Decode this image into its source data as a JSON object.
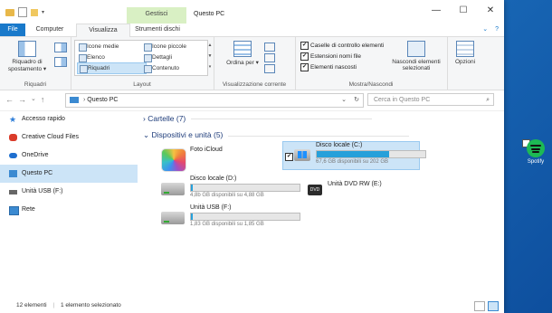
{
  "window": {
    "title": "Questo PC",
    "context_tab": "Gestisci",
    "minimize": "—",
    "maximize": "☐",
    "close": "✕"
  },
  "tabs": {
    "file": "File",
    "computer": "Computer",
    "view": "Visualizza",
    "drive_tools": "Strumenti dischi",
    "expand": "⌄",
    "help": "?"
  },
  "ribbon": {
    "panes": {
      "nav_pane": "Riquadro di spostamento ▾",
      "label": "Riquadri"
    },
    "layout": {
      "items": [
        "Icone medie",
        "Elenco",
        "Riquadri",
        "Icone piccole",
        "Dettagli",
        "Contenuto"
      ],
      "label": "Layout"
    },
    "current_view": {
      "sort": "Ordina per ▾",
      "label": "Visualizzazione corrente"
    },
    "show_hide": {
      "checkboxes": [
        "Caselle di controllo elementi",
        "Estensioni nomi file",
        "Elementi nascosti"
      ],
      "hide_selected": "Nascondi elementi selezionati",
      "label": "Mostra/Nascondi"
    },
    "options": "Opzioni"
  },
  "addressbar": {
    "nav": {
      "back": "←",
      "forward": "→",
      "recent": "⌄",
      "up": "↑"
    },
    "path": "Questo PC",
    "dropdown": "⌄",
    "refresh": "↻",
    "search_placeholder": "Cerca in Questo PC",
    "search_icon": "⌕"
  },
  "sidebar": {
    "items": [
      {
        "label": "Accesso rapido",
        "icon": "star-icon",
        "color": "#2f7ed8"
      },
      {
        "label": "Creative Cloud Files",
        "icon": "creative-cloud-icon",
        "color": "#da3b2a"
      },
      {
        "label": "OneDrive",
        "icon": "cloud-icon",
        "color": "#1e6fcf"
      },
      {
        "label": "Questo PC",
        "icon": "computer-icon",
        "color": "#3b8ad1",
        "selected": true
      },
      {
        "label": "Unità USB (F:)",
        "icon": "usb-drive-icon",
        "color": "#666666"
      },
      {
        "label": "Rete",
        "icon": "network-icon",
        "color": "#3b8ad1"
      }
    ]
  },
  "content": {
    "folders_header": "Cartelle (7)",
    "devices_header": "Dispositivi e unità (5)",
    "devices": [
      {
        "name": "Foto iCloud",
        "free": "",
        "usage": null
      },
      {
        "name": "Disco locale (C:)",
        "free": "67,6 GB disponibili su 202 GB",
        "usage": 0.67,
        "selected": true
      },
      {
        "name": "Disco locale (D:)",
        "free": "4,8b GB disponibili su 4,88 GB",
        "usage": 0.02
      },
      {
        "name": "Unità DVD RW (E:)",
        "free": "",
        "usage": null
      },
      {
        "name": "Unità USB (F:)",
        "free": "1,83 GB disponibili su 1,85 GB",
        "usage": 0.02
      }
    ]
  },
  "status": {
    "count": "12 elementi",
    "selected": "1 elemento selezionato"
  },
  "desktop": {
    "spotify_label": "Spotify"
  },
  "colors": {
    "accent": "#1979ca",
    "selection": "#cce4f7",
    "drive_bar": "#26a0da",
    "spotify": "#1db954"
  }
}
